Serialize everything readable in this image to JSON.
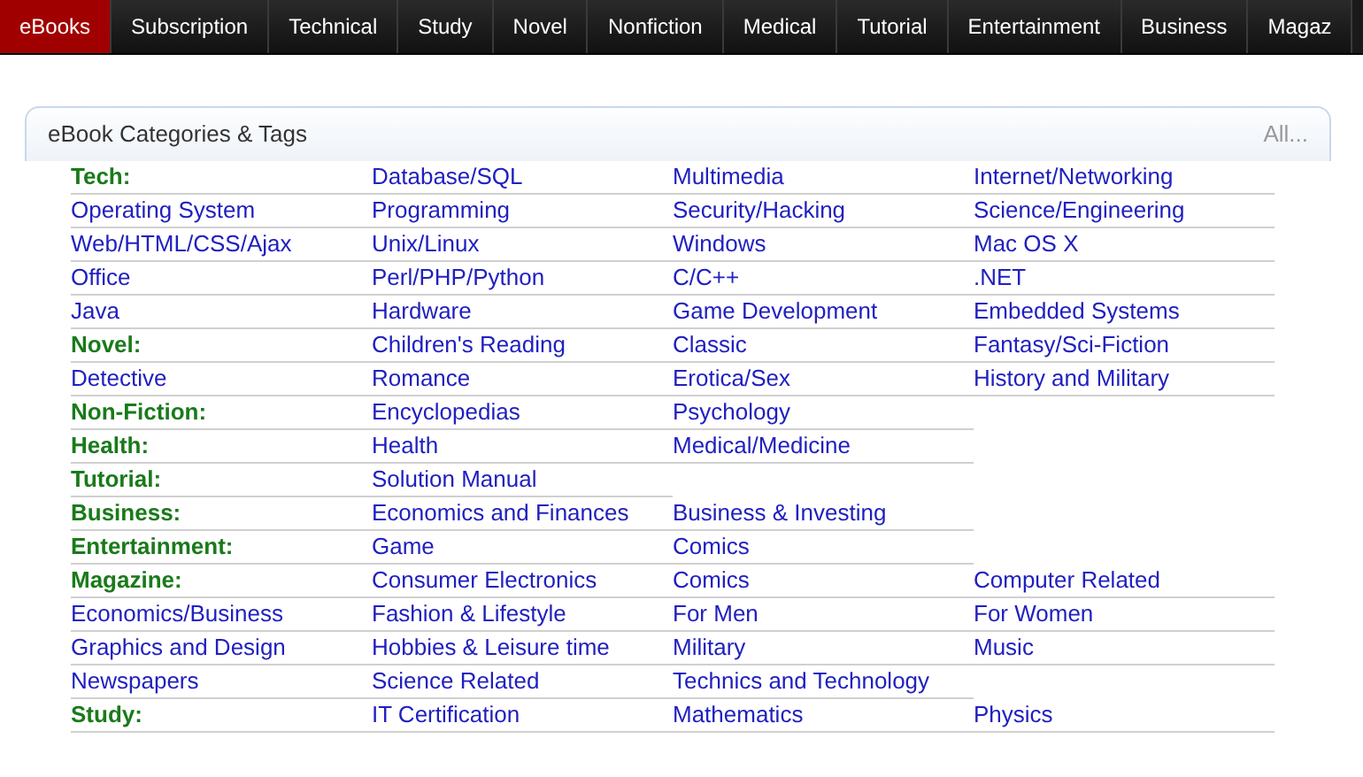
{
  "nav_tabs": [
    {
      "label": "eBooks",
      "selected": true
    },
    {
      "label": "Subscription",
      "selected": false
    },
    {
      "label": "Technical",
      "selected": false
    },
    {
      "label": "Study",
      "selected": false
    },
    {
      "label": "Novel",
      "selected": false
    },
    {
      "label": "Nonfiction",
      "selected": false
    },
    {
      "label": "Medical",
      "selected": false
    },
    {
      "label": "Tutorial",
      "selected": false
    },
    {
      "label": "Entertainment",
      "selected": false
    },
    {
      "label": "Business",
      "selected": false
    },
    {
      "label": "Magaz",
      "selected": false
    }
  ],
  "panel": {
    "title": "eBook Categories & Tags",
    "all_link": "All..."
  },
  "rows": [
    [
      {
        "kind": "category",
        "text": "Tech:"
      },
      {
        "kind": "link",
        "text": "Database/SQL"
      },
      {
        "kind": "link",
        "text": "Multimedia"
      },
      {
        "kind": "link",
        "text": "Internet/Networking"
      }
    ],
    [
      {
        "kind": "link",
        "text": "Operating System"
      },
      {
        "kind": "link",
        "text": "Programming"
      },
      {
        "kind": "link",
        "text": "Security/Hacking"
      },
      {
        "kind": "link",
        "text": "Science/Engineering"
      }
    ],
    [
      {
        "kind": "link",
        "text": "Web/HTML/CSS/Ajax"
      },
      {
        "kind": "link",
        "text": "Unix/Linux"
      },
      {
        "kind": "link",
        "text": "Windows"
      },
      {
        "kind": "link",
        "text": "Mac OS X"
      }
    ],
    [
      {
        "kind": "link",
        "text": "Office"
      },
      {
        "kind": "link",
        "text": "Perl/PHP/Python"
      },
      {
        "kind": "link",
        "text": "C/C++"
      },
      {
        "kind": "link",
        "text": ".NET"
      }
    ],
    [
      {
        "kind": "link",
        "text": "Java"
      },
      {
        "kind": "link",
        "text": "Hardware"
      },
      {
        "kind": "link",
        "text": "Game Development"
      },
      {
        "kind": "link",
        "text": "Embedded Systems"
      }
    ],
    [
      {
        "kind": "category",
        "text": "Novel:"
      },
      {
        "kind": "link",
        "text": "Children's Reading"
      },
      {
        "kind": "link",
        "text": "Classic"
      },
      {
        "kind": "link",
        "text": "Fantasy/Sci-Fiction"
      }
    ],
    [
      {
        "kind": "link",
        "text": "Detective"
      },
      {
        "kind": "link",
        "text": "Romance"
      },
      {
        "kind": "link",
        "text": "Erotica/Sex"
      },
      {
        "kind": "link",
        "text": "History and Military"
      }
    ],
    [
      {
        "kind": "category",
        "text": "Non-Fiction:"
      },
      {
        "kind": "link",
        "text": "Encyclopedias"
      },
      {
        "kind": "link",
        "text": "Psychology"
      }
    ],
    [
      {
        "kind": "category",
        "text": "Health:"
      },
      {
        "kind": "link",
        "text": "Health"
      },
      {
        "kind": "link",
        "text": "Medical/Medicine"
      }
    ],
    [
      {
        "kind": "category",
        "text": "Tutorial:"
      },
      {
        "kind": "link",
        "text": "Solution Manual"
      }
    ],
    [
      {
        "kind": "category",
        "text": "Business:"
      },
      {
        "kind": "link",
        "text": "Economics and Finances"
      },
      {
        "kind": "link",
        "text": "Business & Investing"
      }
    ],
    [
      {
        "kind": "category",
        "text": "Entertainment:"
      },
      {
        "kind": "link",
        "text": "Game"
      },
      {
        "kind": "link",
        "text": "Comics"
      }
    ],
    [
      {
        "kind": "category",
        "text": "Magazine:"
      },
      {
        "kind": "link",
        "text": "Consumer Electronics"
      },
      {
        "kind": "link",
        "text": "Comics"
      },
      {
        "kind": "link",
        "text": "Computer Related"
      }
    ],
    [
      {
        "kind": "link",
        "text": "Economics/Business"
      },
      {
        "kind": "link",
        "text": "Fashion & Lifestyle"
      },
      {
        "kind": "link",
        "text": "For Men"
      },
      {
        "kind": "link",
        "text": "For Women"
      }
    ],
    [
      {
        "kind": "link",
        "text": "Graphics and Design"
      },
      {
        "kind": "link",
        "text": "Hobbies & Leisure time"
      },
      {
        "kind": "link",
        "text": "Military"
      },
      {
        "kind": "link",
        "text": "Music"
      }
    ],
    [
      {
        "kind": "link",
        "text": "Newspapers"
      },
      {
        "kind": "link",
        "text": "Science Related"
      },
      {
        "kind": "link",
        "text": "Technics and Technology"
      }
    ],
    [
      {
        "kind": "category",
        "text": "Study:"
      },
      {
        "kind": "link",
        "text": "IT Certification"
      },
      {
        "kind": "link",
        "text": "Mathematics"
      },
      {
        "kind": "link",
        "text": "Physics"
      }
    ]
  ]
}
